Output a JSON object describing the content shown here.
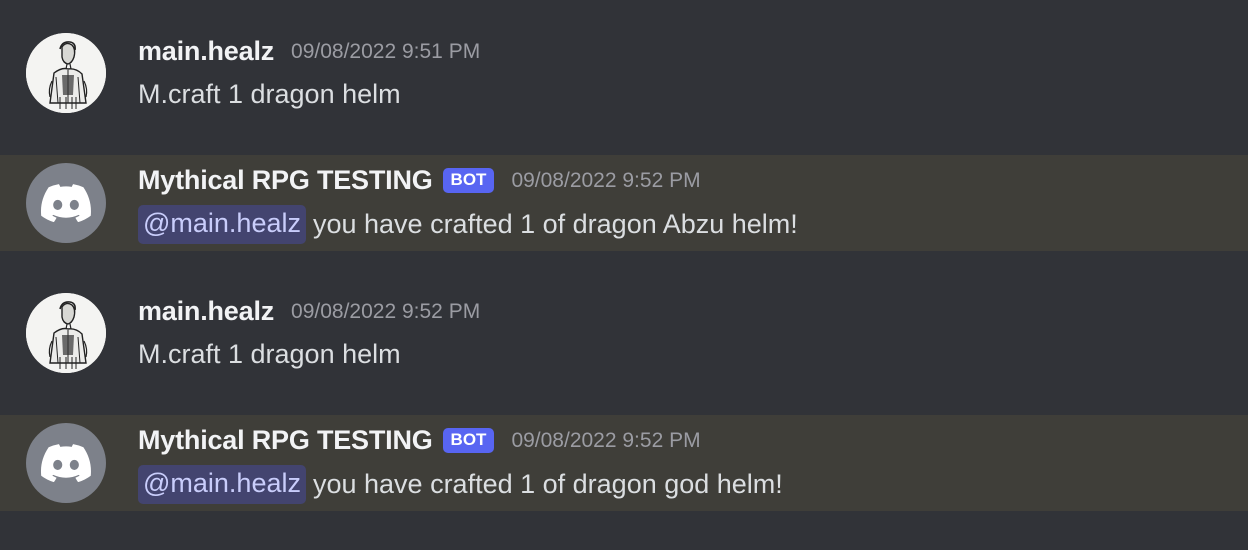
{
  "messages": [
    {
      "author": "main.healz",
      "timestamp": "09/08/2022 9:51 PM",
      "text": "M.craft 1 dragon helm",
      "avatar": "user-portrait-avatar",
      "is_bot": false
    },
    {
      "author": "Mythical RPG TESTING",
      "bot_tag": "BOT",
      "timestamp": "09/08/2022 9:52 PM",
      "mention": "@main.healz",
      "text": "you have crafted 1 of dragon Abzu helm!",
      "avatar": "discord-logo-avatar",
      "is_bot": true
    },
    {
      "author": "main.healz",
      "timestamp": "09/08/2022 9:52 PM",
      "text": "M.craft 1 dragon helm",
      "avatar": "user-portrait-avatar",
      "is_bot": false
    },
    {
      "author": "Mythical RPG TESTING",
      "bot_tag": "BOT",
      "timestamp": "09/08/2022 9:52 PM",
      "mention": "@main.healz",
      "text": "you have crafted 1 of dragon god helm!",
      "avatar": "discord-logo-avatar",
      "is_bot": true
    }
  ],
  "colors": {
    "background": "#313338",
    "highlight": "#3f3e39",
    "bot_tag": "#5865f2",
    "mention_bg": "#43446f",
    "mention_text": "#c9cdfb",
    "username": "#f2f3f5",
    "timestamp": "#9b9ca3",
    "text": "#dbdee1",
    "bot_avatar": "#7d818a"
  }
}
